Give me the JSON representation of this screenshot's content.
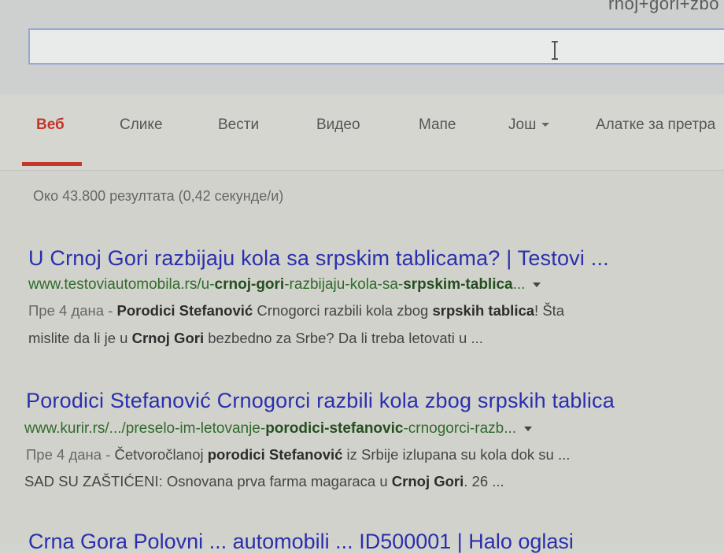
{
  "search": {
    "query_fragment": "rnoj+gori+zbo",
    "value": "",
    "cursor_icon": "text-cursor-icon"
  },
  "tabs": [
    {
      "label": "Веб",
      "active": true
    },
    {
      "label": "Слике"
    },
    {
      "label": "Вести"
    },
    {
      "label": "Видео"
    },
    {
      "label": "Мапе"
    },
    {
      "label": "Још",
      "icon": "chevron-down-icon"
    },
    {
      "label": "Алатке за претра"
    }
  ],
  "stats": "Око 43.800 резултата (0,42 секунде/и)",
  "results": [
    {
      "title": "U Crnoj Gori razbijaju kola sa srpskim tablicama? | Testovi ...",
      "url": [
        {
          "t": "www.testoviautomobila.rs/u-"
        },
        {
          "t": "crnoj-gori",
          "b": true
        },
        {
          "t": "-razbijaju-kola-sa-"
        },
        {
          "t": "srpskim-tablica",
          "b": true
        },
        {
          "t": "..."
        }
      ],
      "snippet": [
        [
          {
            "t": "Пре 4 дана - ",
            "d": true
          },
          {
            "t": "Porodici Stefanović",
            "b": true
          },
          {
            "t": " Crnogorci razbili kola zbog "
          },
          {
            "t": "srpskih tablica",
            "b": true
          },
          {
            "t": "! Šta"
          }
        ],
        [
          {
            "t": "mislite da li je u "
          },
          {
            "t": "Crnoj Gori",
            "b": true
          },
          {
            "t": " bezbedno za Srbe? Da li treba letovati u ..."
          }
        ]
      ]
    },
    {
      "title": "Porodici Stefanović Crnogorci razbili kola zbog srpskih tablica",
      "url": [
        {
          "t": "www.kurir.rs/.../preselo-im-letovanje-"
        },
        {
          "t": "porodici-stefanovic",
          "b": true
        },
        {
          "t": "-crnogorci-razb..."
        }
      ],
      "snippet": [
        [
          {
            "t": "Пре 4 дана - ",
            "d": true
          },
          {
            "t": "Četvoročlanoj "
          },
          {
            "t": "porodici Stefanović",
            "b": true
          },
          {
            "t": " iz Srbije izlupana su kola dok su ..."
          }
        ],
        [
          {
            "t": "SAD SU ZAŠTIĆENI: Osnovana prva farma magaraca u "
          },
          {
            "t": "Crnoj Gori",
            "b": true
          },
          {
            "t": ". 26 ..."
          }
        ]
      ]
    }
  ],
  "partial_next_title": "Crna Gora Polovni ... automobili ... ID500001 | Halo oglasi"
}
